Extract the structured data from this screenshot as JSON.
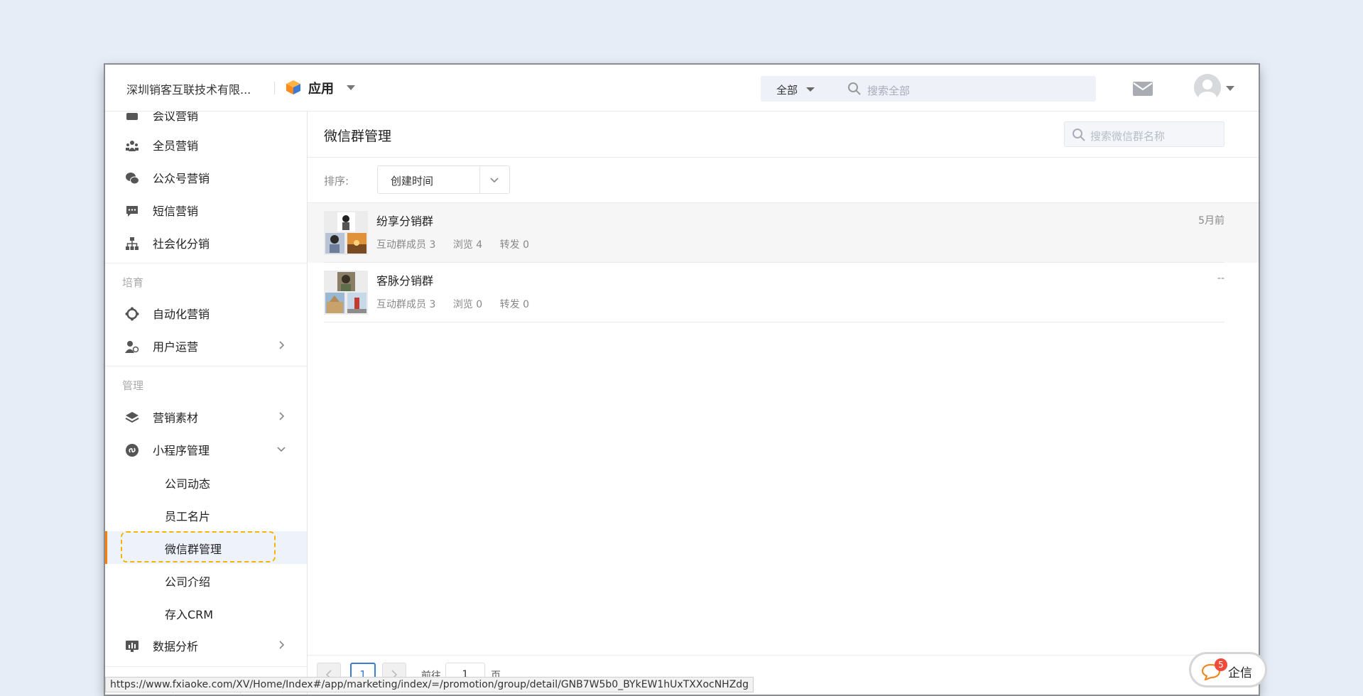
{
  "header": {
    "company": "深圳销客互联技术有限...",
    "app_label": "应用",
    "search_scope": "全部",
    "search_placeholder": "搜索全部"
  },
  "sidebar": {
    "partial_top_item": "会议营销",
    "items_top": [
      {
        "label": "全员营销",
        "icon": "team-icon"
      },
      {
        "label": "公众号营销",
        "icon": "wechat-icon"
      },
      {
        "label": "短信营销",
        "icon": "sms-icon"
      },
      {
        "label": "社会化分销",
        "icon": "org-chart-icon"
      }
    ],
    "group_cultivate": "培育",
    "items_cultivate": [
      {
        "label": "自动化营销",
        "icon": "automation-icon"
      },
      {
        "label": "用户运营",
        "icon": "user-ops-icon"
      }
    ],
    "group_manage": "管理",
    "items_manage": [
      {
        "label": "营销素材",
        "icon": "layers-icon"
      },
      {
        "label": "小程序管理",
        "icon": "miniprogram-icon"
      }
    ],
    "subitems": [
      "公司动态",
      "员工名片",
      "微信群管理",
      "公司介绍",
      "存入CRM"
    ],
    "active_subitem": "微信群管理",
    "data_analysis": "数据分析"
  },
  "main": {
    "title": "微信群管理",
    "search_placeholder": "搜索微信群名称",
    "sort_label": "排序:",
    "sort_value": "创建时间",
    "groups": [
      {
        "name": "纷享分销群",
        "members": "互动群成员 3",
        "views": "浏览 4",
        "shares": "转发 0",
        "time": "5月前"
      },
      {
        "name": "客脉分销群",
        "members": "互动群成员 3",
        "views": "浏览 0",
        "shares": "转发 0",
        "time": "--"
      }
    ],
    "pager": {
      "current": "1",
      "goto_label": "前往",
      "goto_value": "1",
      "unit": "页"
    }
  },
  "qixin": {
    "label": "企信",
    "badge": "5"
  },
  "status_url": "https://www.fxiaoke.com/XV/Home/Index#/app/marketing/index/=/promotion/group/detail/GNB7W5b0_BYkEW1hUxTXXocNHZdg",
  "colors": {
    "accent_orange": "#ff8000",
    "active_bg": "#eef2fb",
    "highlight_dash": "#f5b400",
    "link_blue": "#3a7bd5"
  }
}
